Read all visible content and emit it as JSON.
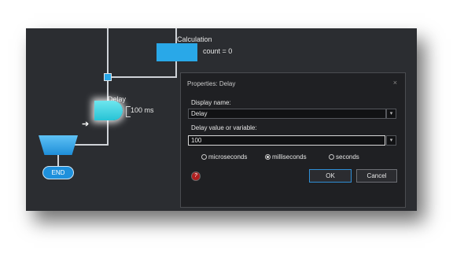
{
  "flowchart": {
    "calculation_label": "Calculation",
    "calculation_expr": "count = 0",
    "delay_label": "Delay",
    "delay_value": "100 ms",
    "end_label": "END"
  },
  "dialog": {
    "title": "Properties: Delay",
    "close_icon": "×",
    "display_name_label": "Display name:",
    "display_name_value": "Delay",
    "delay_value_label": "Delay value or variable:",
    "delay_value": "100",
    "dropdown_icon": "▾",
    "units": [
      {
        "label": "microseconds",
        "selected": false
      },
      {
        "label": "milliseconds",
        "selected": true
      },
      {
        "label": "seconds",
        "selected": false
      }
    ],
    "help_icon_glyph": "?",
    "ok_label": "OK",
    "cancel_label": "Cancel"
  },
  "colors": {
    "accent": "#29a8e8",
    "background": "#2b2d31",
    "dialog_background": "#1f2023",
    "help_red": "#b01e1e"
  }
}
